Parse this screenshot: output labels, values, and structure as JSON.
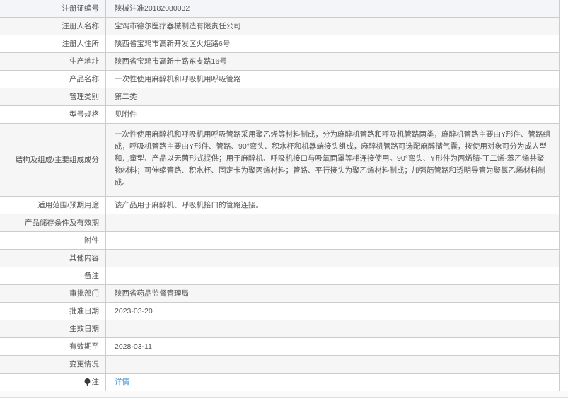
{
  "table": {
    "colors": {
      "highlight": "#f3f5f9",
      "stripe": "#f6f6f6",
      "border": "#cccccc",
      "link": "#4d9ad8",
      "text": "#555555"
    },
    "rows": [
      {
        "label": "注册证编号",
        "value": "陕械注准20182080032"
      },
      {
        "label": "注册人名称",
        "value": "宝鸡市德尔医疗器械制造有限责任公司"
      },
      {
        "label": "注册人住所",
        "value": "陕西省宝鸡市高新开发区火炬路6号"
      },
      {
        "label": "生产地址",
        "value": "陕西省宝鸡市高新十路东支路16号"
      },
      {
        "label": "产品名称",
        "value": "一次性使用麻醉机和呼吸机用呼吸管路"
      },
      {
        "label": "管理类别",
        "value": "第二类"
      },
      {
        "label": "型号规格",
        "value": "见附件"
      },
      {
        "label": "结构及组成/主要组成成分",
        "value": "一次性使用麻醉机和呼吸机用呼吸管路采用聚乙烯等材料制成，分为麻醉机管路和呼吸机管路两类，麻醉机管路主要由Y形件、管路组成，呼吸机管路主要由Y形件、管路、90°弯头、积水杯和机器端接头组成，麻醉机管路可选配麻醉储气囊，按使用对象可分为成人型和儿童型、产品以无菌形式提供；用于麻醉机、呼吸机接口与吸氧面罩等相连接使用。90°弯头、Y形件为丙烯腈-丁二烯-苯乙烯共聚物材料；可伸缩管路、积水杯、固定卡为聚丙烯材料；管路、平行接头为聚乙烯材料制成；加强筋管路和透明导管为聚氯乙烯材料制成。",
        "tall": true
      },
      {
        "label": "适用范围/预期用途",
        "value": "该产品用于麻醉机、呼吸机接口的管路连接。"
      },
      {
        "label": "产品储存条件及有效期",
        "value": ""
      },
      {
        "label": "附件",
        "value": ""
      },
      {
        "label": "其他内容",
        "value": ""
      },
      {
        "label": "备注",
        "value": ""
      },
      {
        "label": "审批部门",
        "value": "陕西省药品监督管理局"
      },
      {
        "label": "批准日期",
        "value": "2023-03-20"
      },
      {
        "label": "生效日期",
        "value": ""
      },
      {
        "label": "有效期至",
        "value": "2028-03-11"
      },
      {
        "label": "变更情况",
        "value": ""
      },
      {
        "label": "注",
        "value": "详情",
        "link": true,
        "icon": "pin-icon"
      }
    ]
  }
}
